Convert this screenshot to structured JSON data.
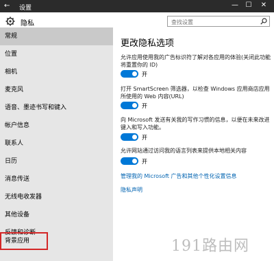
{
  "window": {
    "title": "设置",
    "back_icon": "back-arrow-icon",
    "minimize": "—",
    "maximize": "☐",
    "close": "✕"
  },
  "sidebar": {
    "header_title": "隐私",
    "header_icon": "gear-icon",
    "items": [
      {
        "label": "常规"
      },
      {
        "label": "位置"
      },
      {
        "label": "相机"
      },
      {
        "label": "麦克风"
      },
      {
        "label": "语音、墨迹书写和键入"
      },
      {
        "label": "帐户信息"
      },
      {
        "label": "联系人"
      },
      {
        "label": "日历"
      },
      {
        "label": "消息传送"
      },
      {
        "label": "无线电收发器"
      },
      {
        "label": "其他设备"
      },
      {
        "label": "反馈和诊断"
      },
      {
        "label": "背景应用"
      }
    ]
  },
  "search": {
    "placeholder": "查找设置",
    "icon": "search-icon"
  },
  "main": {
    "title": "更改隐私选项",
    "settings": [
      {
        "desc": "允许应用使用我的广告标识符了解对各应用的体验(关闭此功能将重置你的 ID)",
        "state": "开",
        "on": true
      },
      {
        "desc": "打开 SmartScreen 筛选器，以检查 Windows 应用商店应用所使用的 Web 内容(URL)",
        "state": "开",
        "on": true
      },
      {
        "desc": "向 Microsoft 发送有关我的写作习惯的信息，以便在未来改进键入和写入功能。",
        "state": "开",
        "on": true
      },
      {
        "desc": "允许网站通过访问我的语言列表来提供本地相关内容",
        "state": "开",
        "on": true
      }
    ],
    "links": [
      "管理我的 Microsoft 广告和其他个性化设置信息",
      "隐私声明"
    ]
  },
  "watermark": "191路由网",
  "colors": {
    "accent": "#0078d7",
    "sidebar_bg": "#e6e6e6",
    "selected_bg": "#c9c9c9",
    "highlight_border": "#d32626",
    "link": "#0063b1"
  }
}
